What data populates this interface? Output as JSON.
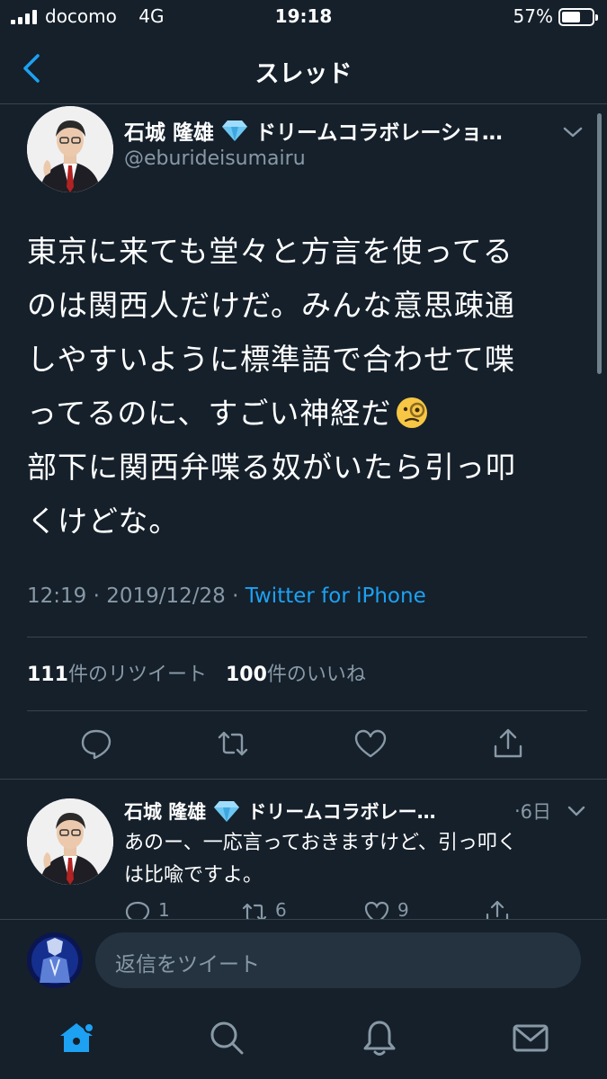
{
  "status_bar": {
    "carrier": "docomo",
    "network": "4G",
    "time": "19:18",
    "battery_percent": "57%"
  },
  "header": {
    "title": "スレッド"
  },
  "main_tweet": {
    "author_name": "石城 隆雄",
    "author_org": "ドリームコラボレーショ…",
    "handle": "@eburideisumairu",
    "text_lines": [
      "東京に来ても堂々と方言を使ってる",
      "のは関西人だけだ。みんな意思疎通",
      "しやすいように標準語で合わせて喋",
      "ってるのに、すごい神経だ",
      "部下に関西弁喋る奴がいたら引っ叩",
      "くけどな。"
    ],
    "time": "12:19",
    "date": "2019/12/28",
    "separator": "·",
    "source": "Twitter for iPhone",
    "retweet_count": "111",
    "retweet_label": "件のリツイート",
    "like_count": "100",
    "like_label": "件のいいね"
  },
  "reply_tweet": {
    "author_name": "石城 隆雄",
    "author_org": "ドリームコラボレー…",
    "time_sep": "·",
    "time": "6日",
    "text_lines": [
      "あのー、一応言っておきますけど、引っ叩く",
      "は比喩ですよ。"
    ],
    "reply_count": "1",
    "retweet_count": "6",
    "like_count": "9"
  },
  "composer": {
    "placeholder": "返信をツイート"
  },
  "tabs": [
    "home-icon",
    "search-icon",
    "bell-icon",
    "mail-icon"
  ],
  "colors": {
    "background": "#15202b",
    "accent": "#1da1f2",
    "secondary_text": "#8899a6",
    "divider": "#38444d"
  }
}
